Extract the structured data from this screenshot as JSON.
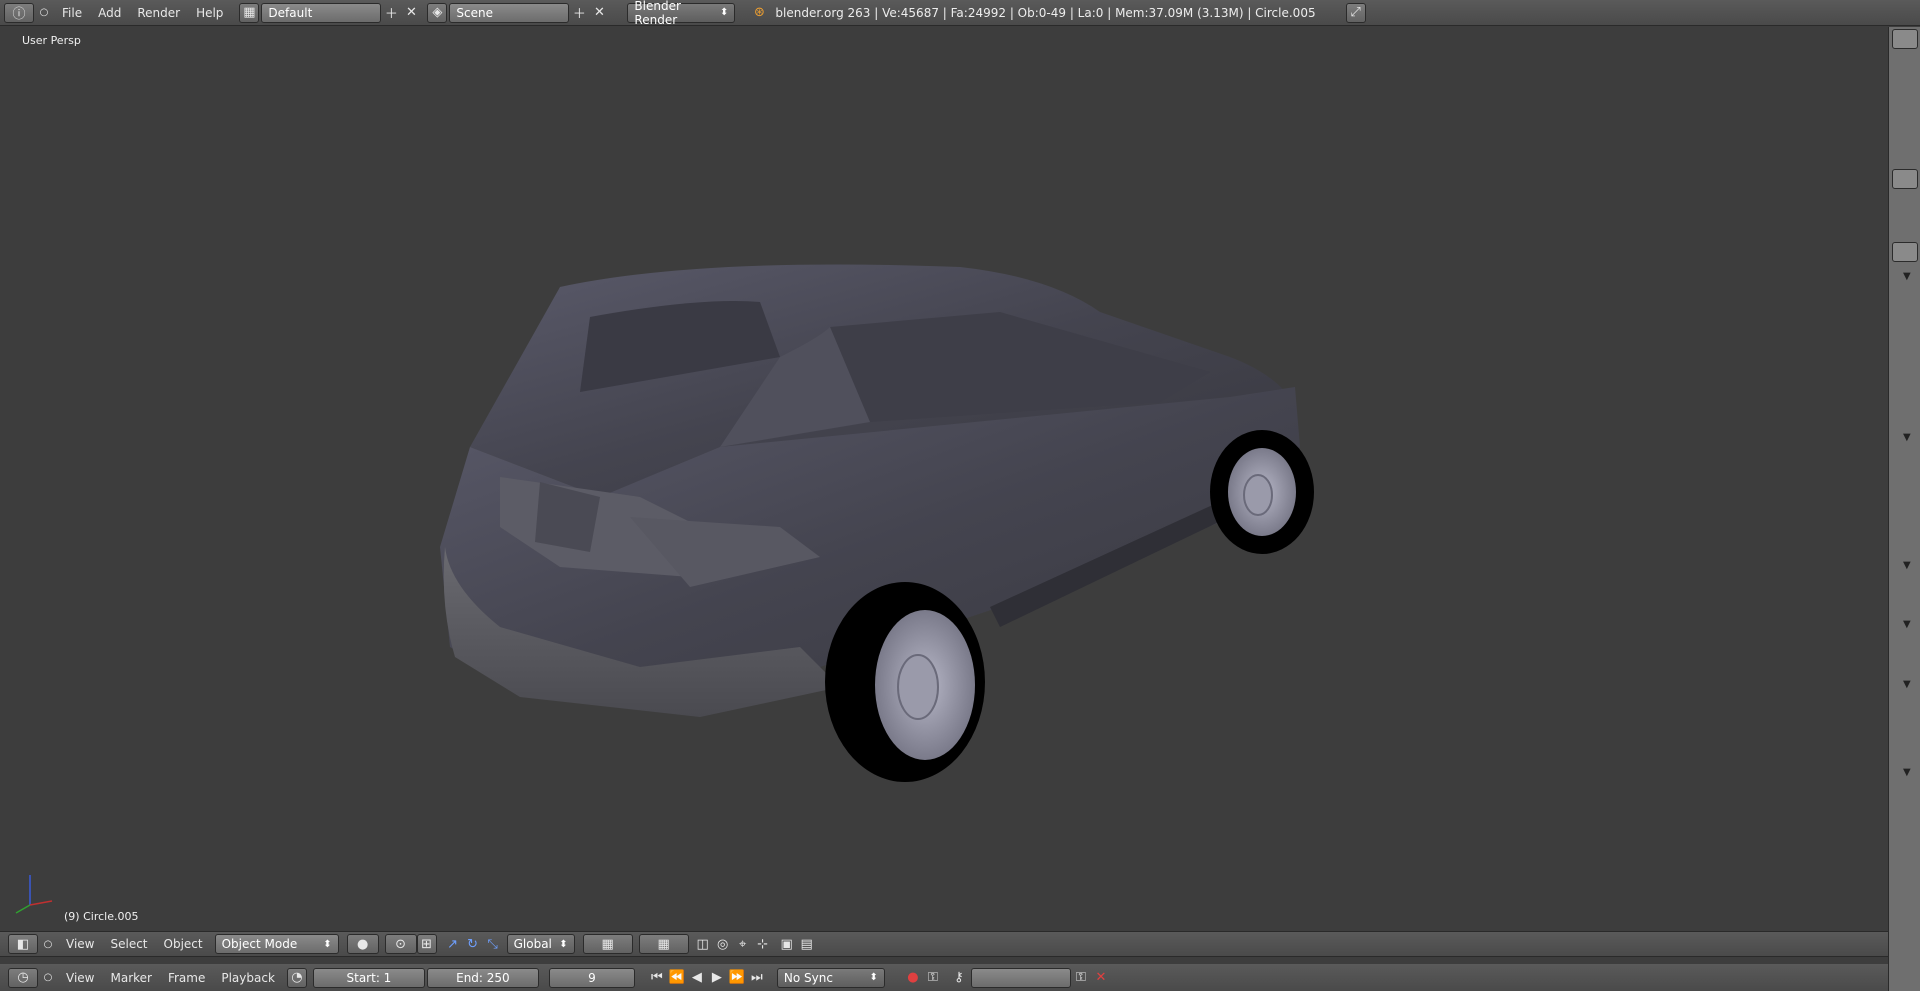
{
  "top_bar": {
    "menus": [
      "File",
      "Add",
      "Render",
      "Help"
    ],
    "layout": "Default",
    "scene": "Scene",
    "engine": "Blender Render",
    "status": "blender.org 263 | Ve:45687 | Fa:24992 | Ob:0-49 | La:0 | Mem:37.09M (3.13M) | Circle.005"
  },
  "viewport": {
    "view_label": "User Persp",
    "object_label": "(9) Circle.005"
  },
  "view_header": {
    "menus": [
      "View",
      "Select",
      "Object"
    ],
    "mode": "Object Mode",
    "orientation": "Global"
  },
  "timeline": {
    "menus": [
      "View",
      "Marker",
      "Frame",
      "Playback"
    ],
    "start": "Start: 1",
    "end": "End: 250",
    "current": "9",
    "sync": "No Sync"
  },
  "colors": {
    "viewport_bg": "#3d3d3d",
    "header_bg": "#505050",
    "car_body": "#4a4a5a"
  }
}
